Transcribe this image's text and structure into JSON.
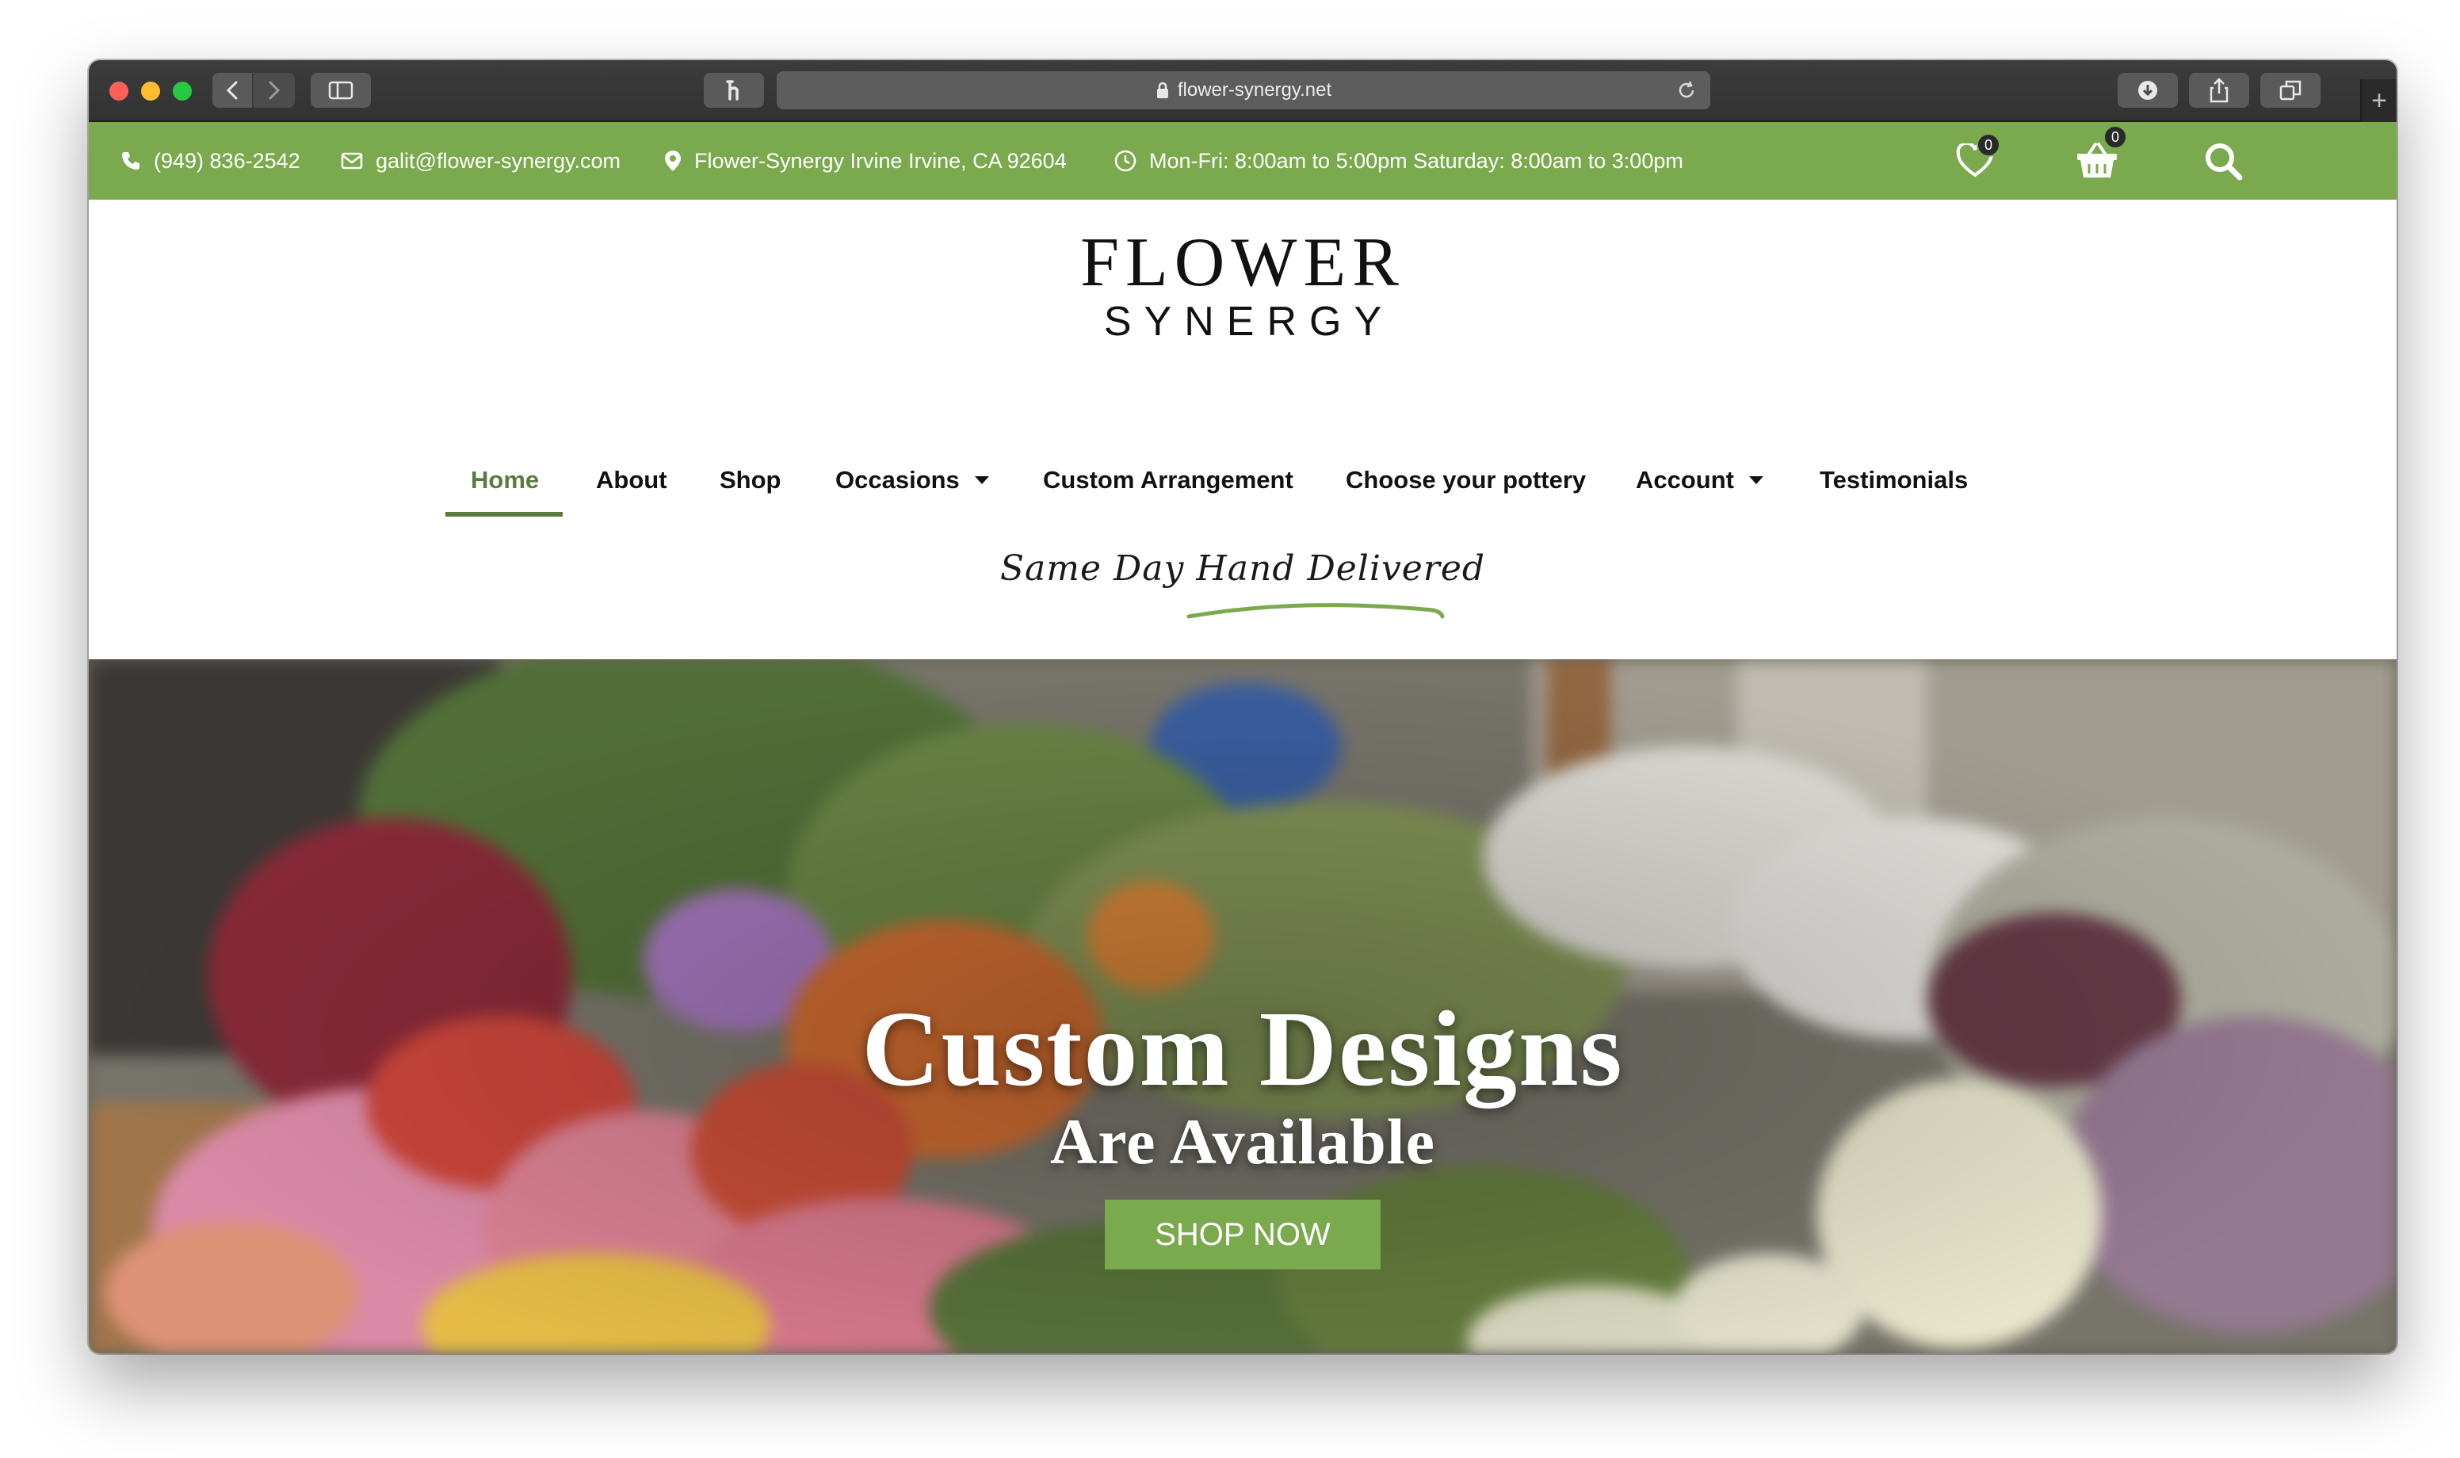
{
  "browser": {
    "url": "flower-synergy.net"
  },
  "topbar": {
    "phone": "(949) 836-2542",
    "email": "galit@flower-synergy.com",
    "address": "Flower-Synergy Irvine Irvine, CA 92604",
    "hours": "Mon-Fri: 8:00am to 5:00pm Saturday: 8:00am to 3:00pm",
    "wishlist_count": "0",
    "cart_count": "0"
  },
  "logo": {
    "top": "FLOWER",
    "bottom": "SYNERGY"
  },
  "nav": {
    "items": [
      {
        "label": "Home",
        "active": true
      },
      {
        "label": "About"
      },
      {
        "label": "Shop"
      },
      {
        "label": "Occasions",
        "dropdown": true
      },
      {
        "label": "Custom Arrangement"
      },
      {
        "label": "Choose your pottery"
      },
      {
        "label": "Account",
        "dropdown": true
      },
      {
        "label": "Testimonials"
      }
    ]
  },
  "tagline": "Same Day Hand Delivered",
  "hero": {
    "title": "Custom Designs",
    "subtitle": "Are Available",
    "cta": "SHOP NOW"
  },
  "colors": {
    "brand_green": "#7ba94e",
    "nav_active": "#5b7a3f"
  },
  "icons": {
    "phone": "phone-icon",
    "email": "envelope-icon",
    "address": "map-pin-icon",
    "hours": "clock-icon",
    "wishlist": "heart-icon",
    "cart": "basket-icon",
    "search": "search-icon"
  }
}
